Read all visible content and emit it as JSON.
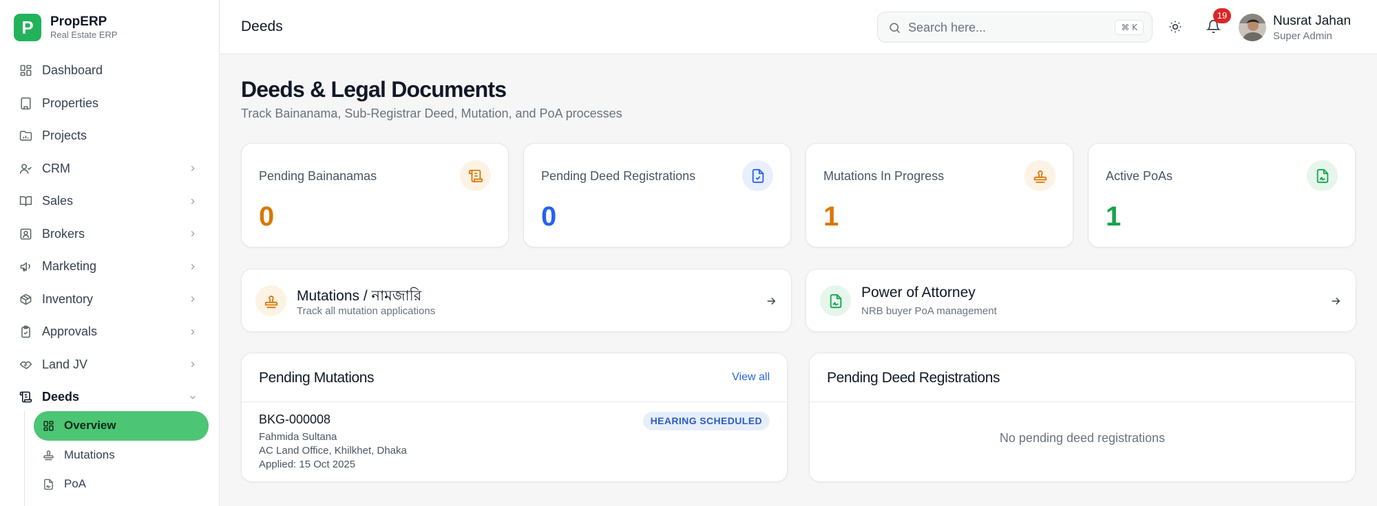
{
  "brand": {
    "initial": "P",
    "name": "PropERP",
    "subtitle": "Real Estate ERP",
    "color": "#22b25a"
  },
  "sidebar": {
    "items": [
      {
        "label": "Dashboard",
        "icon": "grid-icon"
      },
      {
        "label": "Properties",
        "icon": "building-icon"
      },
      {
        "label": "Projects",
        "icon": "folder-icon"
      },
      {
        "label": "CRM",
        "icon": "user-check-icon"
      },
      {
        "label": "Sales",
        "icon": "book-open-icon"
      },
      {
        "label": "Brokers",
        "icon": "contact-icon"
      },
      {
        "label": "Marketing",
        "icon": "megaphone-icon"
      },
      {
        "label": "Inventory",
        "icon": "package-icon"
      },
      {
        "label": "Approvals",
        "icon": "clipboard-check-icon"
      },
      {
        "label": "Land JV",
        "icon": "handshake-icon"
      },
      {
        "label": "Deeds",
        "icon": "scroll-icon"
      }
    ],
    "deeds_sub": [
      {
        "label": "Overview",
        "icon": "grid-icon",
        "active": true
      },
      {
        "label": "Mutations",
        "icon": "stamp-icon"
      },
      {
        "label": "PoA",
        "icon": "file-signature-icon"
      }
    ]
  },
  "header": {
    "title": "Deeds",
    "search_placeholder": "Search here...",
    "search_shortcut": "⌘ K",
    "notification_count": "19",
    "user_name": "Nusrat Jahan",
    "user_role": "Super Admin"
  },
  "page": {
    "title": "Deeds & Legal Documents",
    "subtitle": "Track Bainanama, Sub-Registrar Deed, Mutation, and PoA processes"
  },
  "stats": [
    {
      "label": "Pending Bainanamas",
      "value": "0",
      "color": "#d97706",
      "bg": "#fdf3e4",
      "icon": "scroll-icon"
    },
    {
      "label": "Pending Deed Registrations",
      "value": "0",
      "color": "#2563eb",
      "bg": "#e9effc",
      "icon": "file-check-icon"
    },
    {
      "label": "Mutations In Progress",
      "value": "1",
      "color": "#d97706",
      "bg": "#fdf3e4",
      "icon": "stamp-icon"
    },
    {
      "label": "Active PoAs",
      "value": "1",
      "color": "#16a34a",
      "bg": "#e6f6ec",
      "icon": "file-signature-icon"
    }
  ],
  "links": [
    {
      "title": "Mutations / নামজারি",
      "subtitle": "Track all mutation applications",
      "icon": "stamp-icon",
      "color": "#d97706",
      "bg": "#fdf3e4"
    },
    {
      "title": "Power of Attorney",
      "subtitle": "NRB buyer PoA management",
      "icon": "file-signature-icon",
      "color": "#16a34a",
      "bg": "#e6f6ec"
    }
  ],
  "pending_mutations": {
    "title": "Pending Mutations",
    "view_all": "View all",
    "rows": [
      {
        "id": "BKG-000008",
        "name": "Fahmida Sultana",
        "office": "AC Land Office, Khilkhet, Dhaka",
        "applied": "Applied: 15 Oct 2025",
        "status": "HEARING SCHEDULED"
      }
    ]
  },
  "pending_deeds": {
    "title": "Pending Deed Registrations",
    "empty_text": "No pending deed registrations"
  }
}
